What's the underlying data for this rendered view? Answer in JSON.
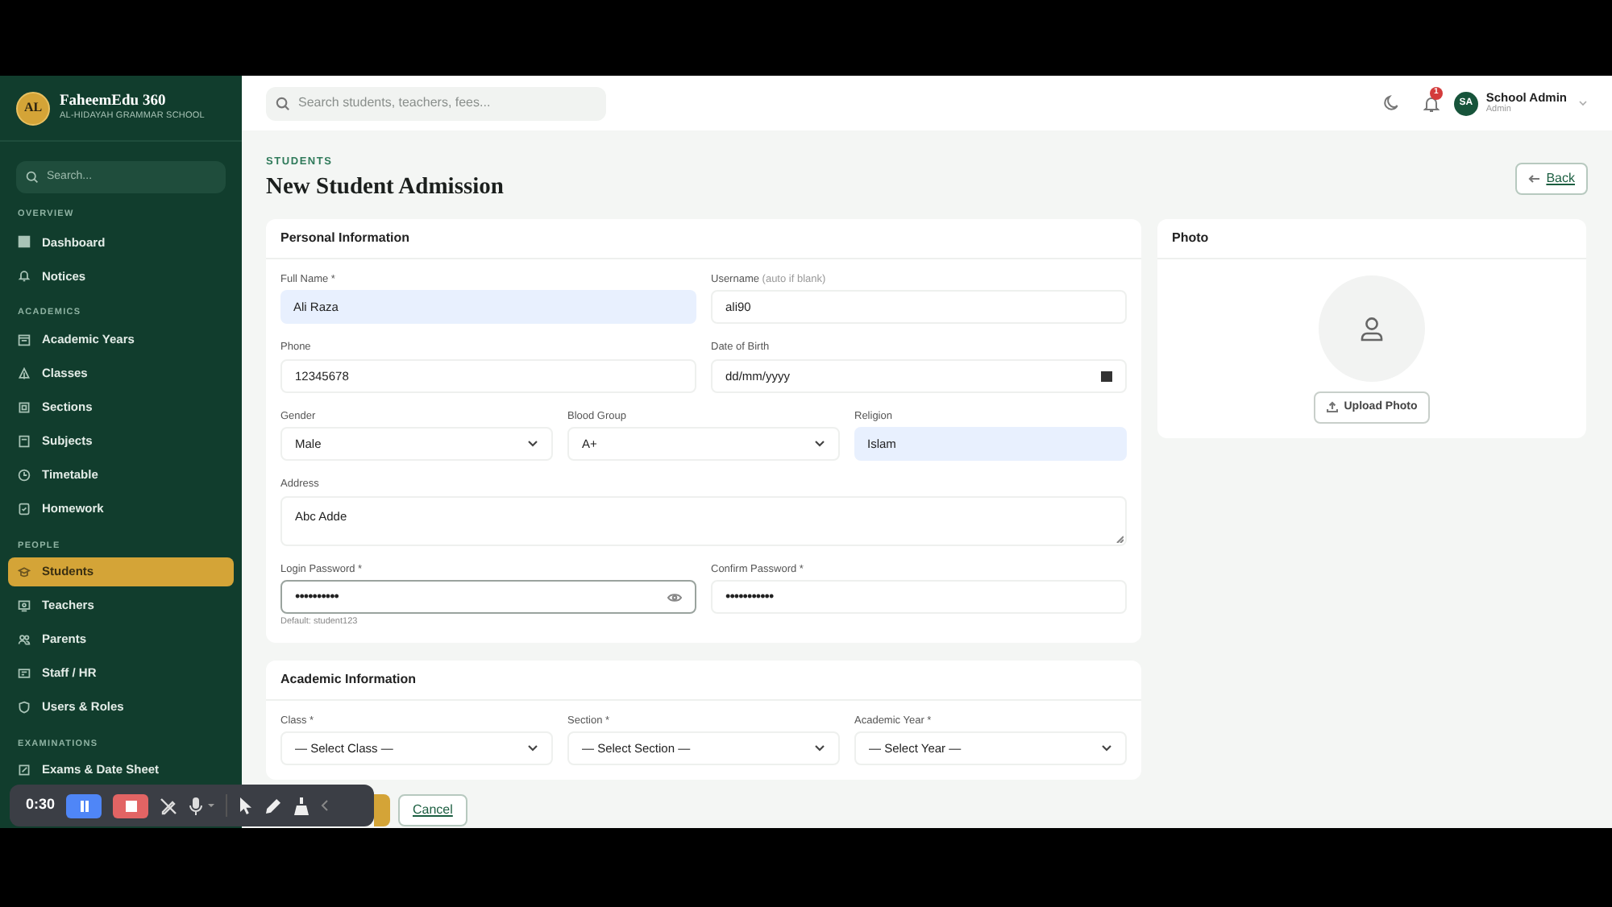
{
  "brand": {
    "initials": "AL",
    "name": "FaheemEdu 360",
    "school": "AL-HIDAYAH GRAMMAR SCHOOL"
  },
  "sidebar": {
    "search_placeholder": "Search...",
    "sections": [
      {
        "title": "OVERVIEW",
        "items": [
          {
            "label": "Dashboard",
            "selected": false
          },
          {
            "label": "Notices",
            "selected": false
          }
        ]
      },
      {
        "title": "ACADEMICS",
        "items": [
          {
            "label": "Academic Years",
            "selected": false
          },
          {
            "label": "Classes",
            "selected": false
          },
          {
            "label": "Sections",
            "selected": false
          },
          {
            "label": "Subjects",
            "selected": false
          },
          {
            "label": "Timetable",
            "selected": false
          },
          {
            "label": "Homework",
            "selected": false
          }
        ]
      },
      {
        "title": "PEOPLE",
        "items": [
          {
            "label": "Students",
            "selected": true
          },
          {
            "label": "Teachers",
            "selected": false
          },
          {
            "label": "Parents",
            "selected": false
          },
          {
            "label": "Staff / HR",
            "selected": false
          },
          {
            "label": "Users & Roles",
            "selected": false
          }
        ]
      },
      {
        "title": "EXAMINATIONS",
        "items": [
          {
            "label": "Exams & Date Sheet",
            "selected": false
          }
        ]
      }
    ]
  },
  "topbar": {
    "search_placeholder": "Search students, teachers, fees...",
    "notifications": "1",
    "user": {
      "initials": "SA",
      "name": "School Admin",
      "role": "Admin"
    }
  },
  "page": {
    "breadcrumb": "STUDENTS",
    "title": "New Student Admission",
    "back": "Back"
  },
  "personal": {
    "title": "Personal Information",
    "rows": [
      [
        {
          "kind": "text",
          "label": "Full Name *",
          "value": "Ali Raza",
          "autofilled": true
        },
        {
          "kind": "text",
          "label": "Username",
          "note": "(auto if blank)",
          "value": "ali90",
          "autofilled": false
        }
      ],
      [
        {
          "kind": "text",
          "label": "Phone",
          "value": "12345678",
          "autofilled": false
        },
        {
          "kind": "date",
          "label": "Date of Birth",
          "value": "dd/mm/yyyy"
        }
      ],
      [
        {
          "kind": "select",
          "label": "Gender",
          "value": "Male"
        },
        {
          "kind": "select",
          "label": "Blood Group",
          "value": "A+"
        },
        {
          "kind": "text",
          "label": "Religion",
          "value": "Islam",
          "autofilled": true
        }
      ],
      [
        {
          "kind": "textarea",
          "label": "Address",
          "value": "Abc Adde"
        }
      ],
      [
        {
          "kind": "password",
          "label": "Login Password *",
          "value": "••••••••••",
          "focused": true,
          "hint": "Default: student123"
        },
        {
          "kind": "password",
          "label": "Confirm Password *",
          "value": "•••••••••••",
          "focused": false
        }
      ]
    ]
  },
  "photo": {
    "title": "Photo",
    "upload": "Upload Photo"
  },
  "academic": {
    "title": "Academic Information",
    "rows": [
      [
        {
          "kind": "select",
          "label": "Class *",
          "value": "— Select Class —"
        },
        {
          "kind": "select",
          "label": "Section *",
          "value": "— Select Section —"
        },
        {
          "kind": "select",
          "label": "Academic Year *",
          "value": "— Select Year —"
        }
      ]
    ]
  },
  "actions": {
    "cancel": "Cancel"
  },
  "recorder": {
    "time": "0:30"
  }
}
